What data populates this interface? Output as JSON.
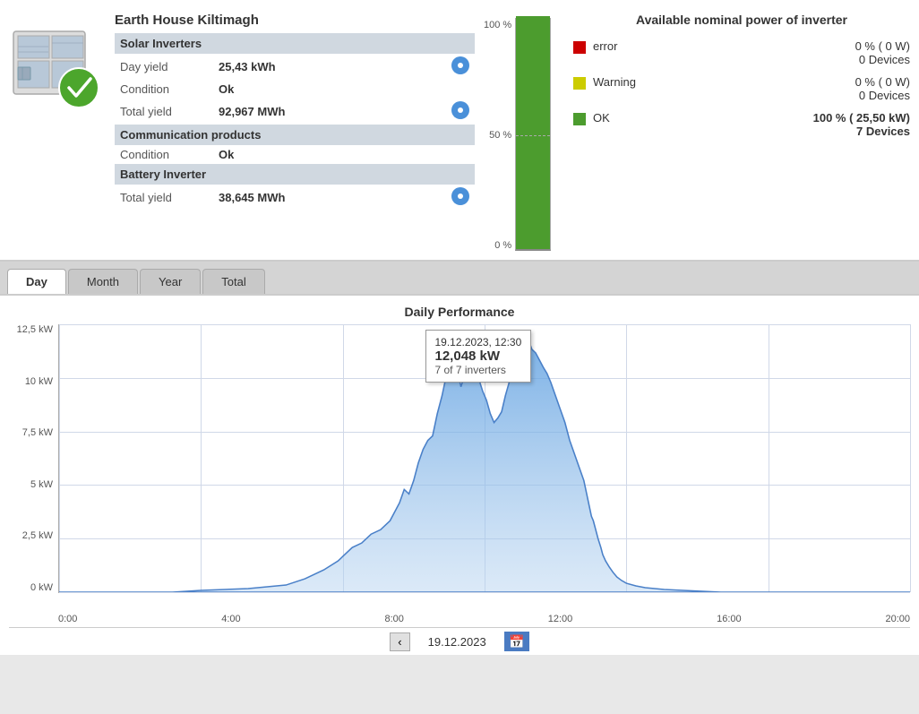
{
  "header": {
    "device_name": "Earth House Kiltimagh"
  },
  "solar_inverters": {
    "section_title": "Solar Inverters",
    "day_yield_label": "Day yield",
    "day_yield_value": "25,43 kWh",
    "condition_label": "Condition",
    "condition_value": "Ok",
    "total_yield_label": "Total yield",
    "total_yield_value": "92,967 MWh"
  },
  "communication": {
    "section_title": "Communication products",
    "condition_label": "Condition",
    "condition_value": "Ok"
  },
  "battery_inverter": {
    "section_title": "Battery Inverter",
    "total_yield_label": "Total yield",
    "total_yield_value": "38,645 MWh"
  },
  "power_chart": {
    "title": "Available nominal power of inverter",
    "bar_100_label": "100 %",
    "bar_50_label": "50 %",
    "bar_0_label": "0 %",
    "legend": {
      "error": {
        "label": "error",
        "pct": "0 %  ( 0 W)",
        "devices": "0 Devices",
        "color": "#c00"
      },
      "warning": {
        "label": "Warning",
        "pct": "0 %  ( 0 W)",
        "devices": "0 Devices",
        "color": "#cc0"
      },
      "ok": {
        "label": "OK",
        "pct": "100 %  ( 25,50 kW)",
        "devices": "7 Devices",
        "color": "#4c9c2e"
      }
    }
  },
  "tabs": [
    "Day",
    "Month",
    "Year",
    "Total"
  ],
  "active_tab": "Day",
  "chart": {
    "title": "Daily Performance",
    "y_labels": [
      "12,5 kW",
      "10 kW",
      "7,5 kW",
      "5 kW",
      "2,5 kW",
      "0 kW"
    ],
    "x_labels": [
      "0:00",
      "4:00",
      "8:00",
      "12:00",
      "16:00",
      "20:00"
    ],
    "tooltip": {
      "time": "19.12.2023, 12:30",
      "value": "12,048 kW",
      "sub": "7 of 7 inverters"
    }
  },
  "bottom": {
    "date": "19.12.2023",
    "nav_prev": "‹",
    "calendar_icon": "📅"
  }
}
